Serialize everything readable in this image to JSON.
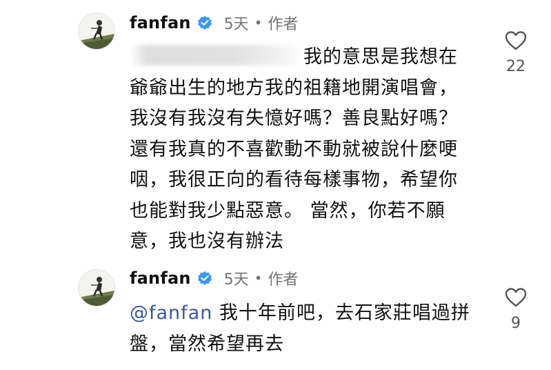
{
  "comments": [
    {
      "username": "fanfan",
      "time": "5天",
      "separator": "•",
      "author_tag": "作者",
      "lines": [
        "我的意思是我想在",
        "爺爺出生的地方我的祖籍地開演唱會，",
        "我沒有我沒有失憶好嗎？善良點好嗎？",
        "還有我真的不喜歡動不動就被說什麼哽",
        "咽，我很正向的看待每樣事物，希望你",
        "也能對我少點惡意。 當然，你若不願",
        "意，我也沒有辦法"
      ],
      "likes": "22"
    },
    {
      "username": "fanfan",
      "time": "5天",
      "separator": "•",
      "author_tag": "作者",
      "mention": "@fanfan",
      "lines": [
        " 我十年前吧，去石家莊唱過拼",
        "盤，當然希望再去"
      ],
      "likes": "9"
    }
  ],
  "colors": {
    "verified_badge": "#3897f0",
    "mention": "#385898",
    "secondary_text": "#737373"
  },
  "icons": {
    "verified": "verified-badge-icon",
    "like": "heart-outline-icon"
  }
}
